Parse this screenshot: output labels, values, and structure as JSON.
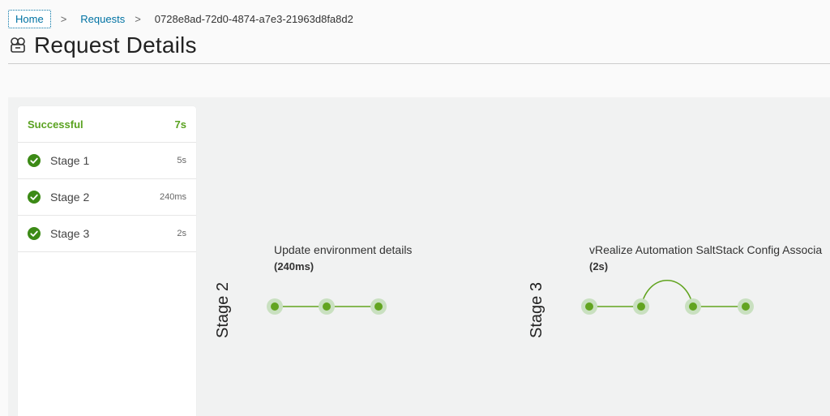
{
  "breadcrumb": {
    "home": "Home",
    "requests": "Requests",
    "current": "0728e8ad-72d0-4874-a7e3-21963d8fa8d2",
    "separator": ">"
  },
  "page": {
    "title": "Request Details",
    "title_icon": "request-icon"
  },
  "summary": {
    "status": "Successful",
    "duration": "7s",
    "status_color": "#5aa220"
  },
  "stages": [
    {
      "name": "Stage 1",
      "duration": "5s",
      "status": "success"
    },
    {
      "name": "Stage 2",
      "duration": "240ms",
      "status": "success"
    },
    {
      "name": "Stage 3",
      "duration": "2s",
      "status": "success"
    }
  ],
  "flow": {
    "stage2": {
      "label": "Stage 2",
      "task_title": "Update environment details",
      "task_time": "(240ms)"
    },
    "stage3": {
      "label": "Stage 3",
      "task_title": "vRealize Automation SaltStack Config Associa",
      "task_time": "(2s)"
    }
  },
  "colors": {
    "accent": "#0072a3",
    "success": "#5aa220",
    "node": "#62a420",
    "node_halo": "#c9e0c0",
    "canvas": "#f1f2f2"
  }
}
